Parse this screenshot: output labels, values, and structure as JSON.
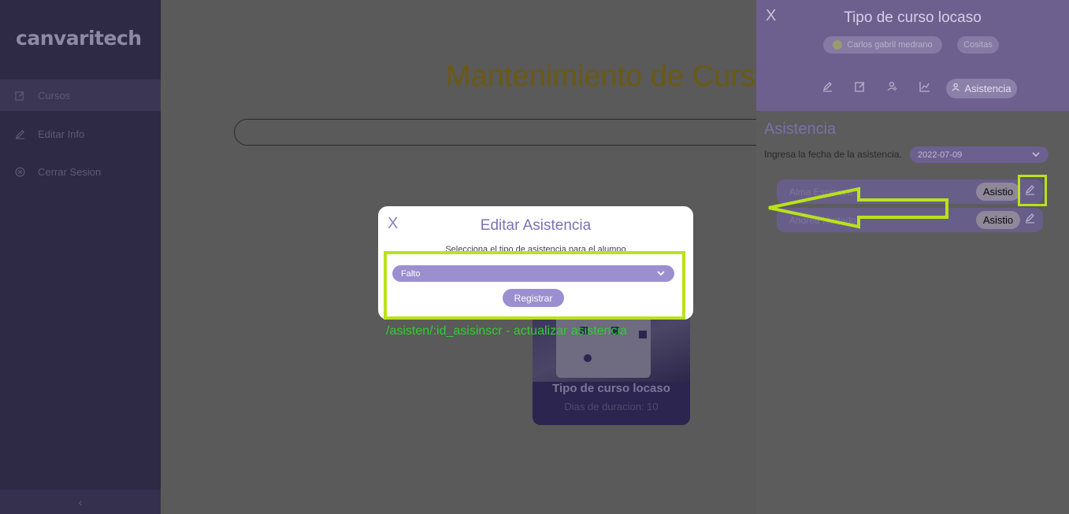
{
  "app": {
    "logo": "canvaritech"
  },
  "sidebar": {
    "items": [
      {
        "label": "Cursos",
        "icon": "edit-icon"
      },
      {
        "label": "Editar Info",
        "icon": "pencil-icon"
      },
      {
        "label": "Cerrar Sesion",
        "icon": "close-circle-icon"
      }
    ],
    "collapse_icon": "chevron-left-icon"
  },
  "main": {
    "title": "Mantenimiento de Curs",
    "course_card": {
      "title": "Tipo de curso locaso",
      "subtitle": "Dias de duracion: 10"
    }
  },
  "modal": {
    "close": "X",
    "title": "Editar Asistencia",
    "subtitle": "Selecciona el tipo de asistencia para el alumno",
    "select_value": "Falto",
    "submit_label": "Registrar"
  },
  "annotation": {
    "text": "/asisten/:id_asisinscr - actualizar asistencia",
    "color": "#b9e21c",
    "text_color": "#33cc33"
  },
  "right_panel": {
    "close": "X",
    "title": "Tipo de curso locaso",
    "chips": [
      "Carlos gabril medrano",
      "Cositas"
    ],
    "tabs": [
      {
        "icon": "pencil-icon"
      },
      {
        "icon": "edit-icon"
      },
      {
        "icon": "users-icon"
      },
      {
        "icon": "chart-icon"
      },
      {
        "icon": "users-icon",
        "label": "Asistencia",
        "active": true
      }
    ],
    "section_title": "Asistencia",
    "date_label": "Ingresa la fecha de la asistencia.",
    "date_value": "2022-07-09",
    "students": [
      {
        "name": "Alma Espinoza",
        "status": "Asistio"
      },
      {
        "name": "Andrea Hurtado",
        "status": "Asistio"
      }
    ]
  },
  "colors": {
    "sidebar_bg": "#2e2a45",
    "accent_purple": "#9b8fd0",
    "highlight": "#b9e21c"
  }
}
